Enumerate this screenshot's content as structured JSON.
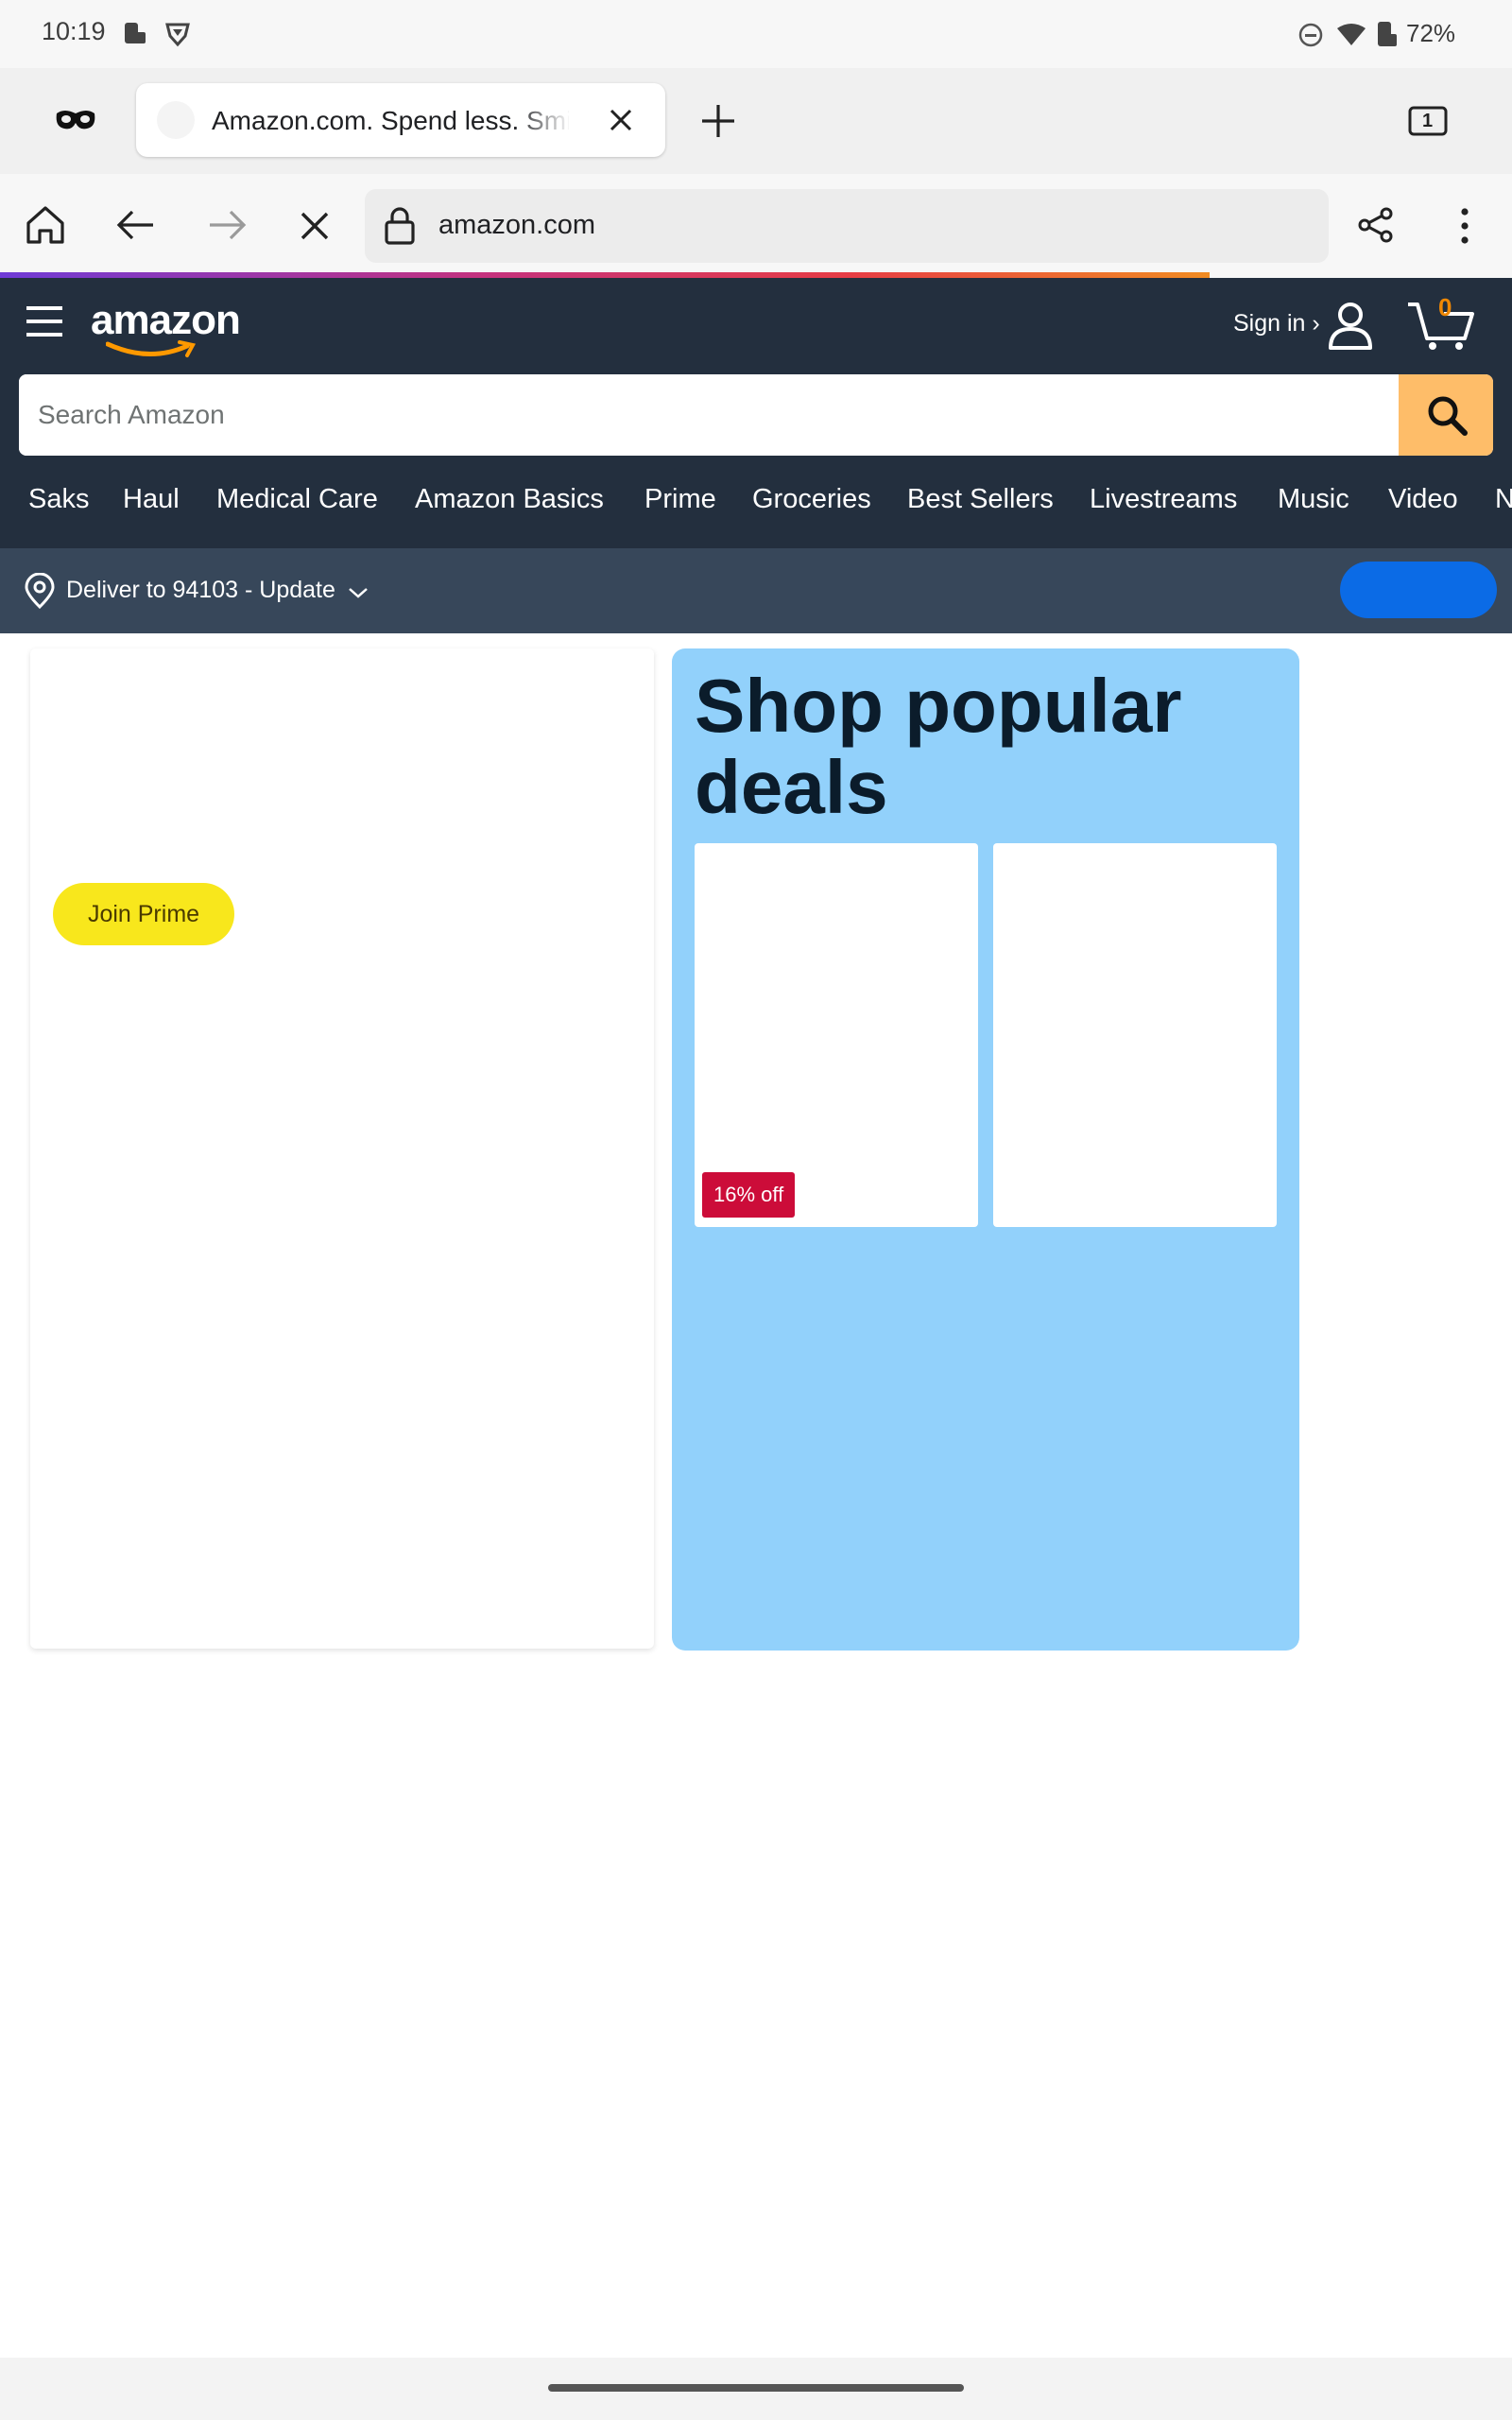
{
  "status_bar": {
    "time": "10:19",
    "battery": "72%"
  },
  "browser": {
    "tab_title": "Amazon.com. Spend less. Smile more.",
    "tab_count": "1",
    "url": "amazon.com"
  },
  "amazon": {
    "logo": "amazon",
    "sign_in": "Sign in ›",
    "cart_count": "0",
    "search_placeholder": "Search Amazon",
    "nav": [
      "Saks",
      "Haul",
      "Medical Care",
      "Amazon Basics",
      "Prime",
      "Groceries",
      "Best Sellers",
      "Livestreams",
      "Music",
      "Video",
      "N"
    ],
    "deliver": "Deliver to 94103 - Update"
  },
  "prime_card": {
    "button": "Join Prime"
  },
  "deals_card": {
    "title": "Shop popular deals",
    "badge": "16% off"
  },
  "colors": {
    "header_bg": "#232f3e",
    "deliver_bg": "#37475a",
    "search_button": "#febd69",
    "deals_bg": "#92d1fb",
    "badge": "#cc0c39",
    "prime_button": "#f8e71c"
  }
}
